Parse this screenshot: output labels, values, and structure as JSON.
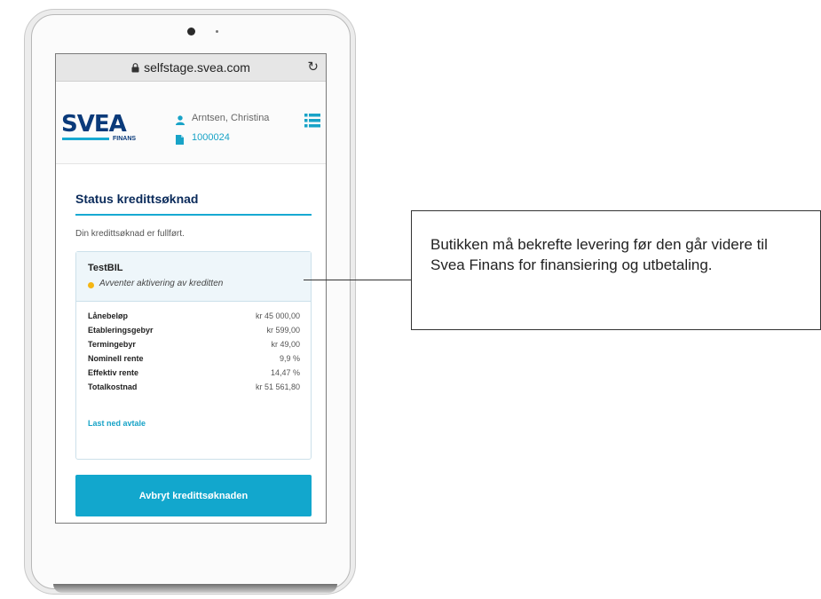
{
  "browser": {
    "url": "selfstage.svea.com"
  },
  "header": {
    "logo_text": "SVEA",
    "logo_sub": "FINANS",
    "user_name": "Arntsen, Christina",
    "document_number": "1000024"
  },
  "page": {
    "title": "Status kredittsøknad",
    "status_message": "Din kredittsøknad er fullført."
  },
  "application": {
    "name": "TestBIL",
    "status": "Avventer aktivering av kreditten",
    "rows": [
      {
        "label": "Lånebeløp",
        "value": "kr 45 000,00"
      },
      {
        "label": "Etableringsgebyr",
        "value": "kr 599,00"
      },
      {
        "label": "Termingebyr",
        "value": "kr 49,00"
      },
      {
        "label": "Nominell rente",
        "value": "9,9 %"
      },
      {
        "label": "Effektiv rente",
        "value": "14,47 %"
      },
      {
        "label": "Totalkostnad",
        "value": "kr 51 561,80"
      }
    ],
    "download_label": "Last ned avtale"
  },
  "actions": {
    "cancel_label": "Avbryt kredittsøknaden"
  },
  "callout": {
    "text": "Butikken må bekrefte levering før den går videre til Svea Finans for finansiering og utbetaling."
  },
  "colors": {
    "accent": "#12a7cd",
    "brand_navy": "#0a3a7a",
    "status_pending": "#f5b614"
  }
}
